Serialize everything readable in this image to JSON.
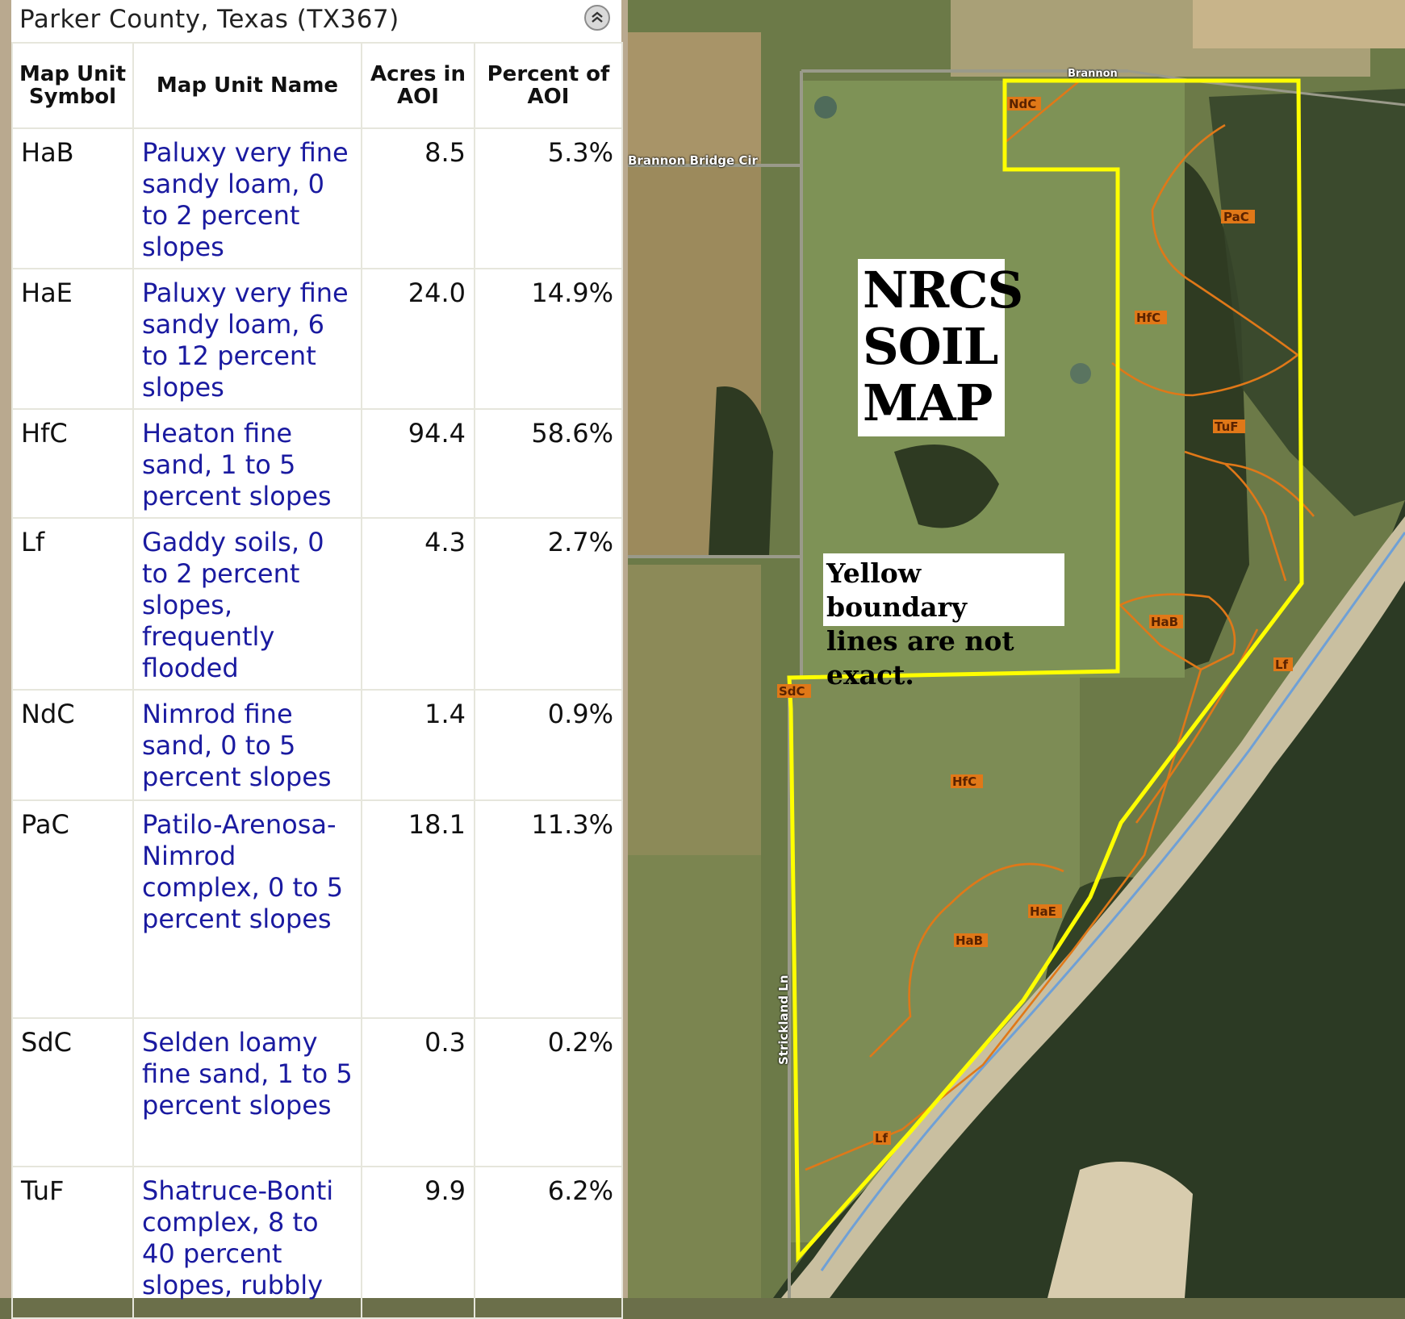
{
  "panel": {
    "title": "Parker County, Texas (TX367)",
    "collapse_icon": "double-chevron-up-icon"
  },
  "table": {
    "headers": {
      "symbol": "Map Unit Symbol",
      "name": "Map Unit Name",
      "acres": "Acres in AOI",
      "percent": "Percent of AOI"
    },
    "rows": [
      {
        "symbol": "HaB",
        "name": "Paluxy very fine sandy loam, 0 to 2 percent slopes",
        "acres": "8.5",
        "percent": "5.3%"
      },
      {
        "symbol": "HaE",
        "name": "Paluxy very fine sandy loam, 6 to 12 percent slopes",
        "acres": "24.0",
        "percent": "14.9%"
      },
      {
        "symbol": "HfC",
        "name": "Heaton fine sand, 1 to 5 percent slopes",
        "acres": "94.4",
        "percent": "58.6%"
      },
      {
        "symbol": "Lf",
        "name": "Gaddy soils, 0 to 2 percent slopes, frequently flooded",
        "acres": "4.3",
        "percent": "2.7%"
      },
      {
        "symbol": "NdC",
        "name": "Nimrod fine sand, 0 to 5 percent slopes",
        "acres": "1.4",
        "percent": "0.9%"
      },
      {
        "symbol": "PaC",
        "name": "Patilo-Arenosa-Nimrod complex, 0 to 5 percent slopes",
        "acres": "18.1",
        "percent": "11.3%"
      },
      {
        "symbol": "SdC",
        "name": "Selden loamy fine sand, 1 to 5 percent slopes",
        "acres": "0.3",
        "percent": "0.2%"
      },
      {
        "symbol": "TuF",
        "name": "Shatruce-Bonti complex, 8 to 40 percent slopes, rubbly",
        "acres": "9.9",
        "percent": "6.2%"
      }
    ]
  },
  "map": {
    "title_lines": [
      "NRCS",
      "SOIL",
      "MAP"
    ],
    "note_lines": [
      "Yellow boundary",
      "lines are not exact."
    ],
    "road_labels": {
      "brannon": "Brannon Bridge Cir",
      "strickland": "Strickland Ln",
      "top": "Brannon"
    },
    "soil_labels": [
      "NdC",
      "PaC",
      "HfC",
      "TuF",
      "HaB",
      "Lf",
      "SdC",
      "HfC",
      "HaE",
      "HaB",
      "Lf"
    ],
    "colors": {
      "boundary": "#ffff00",
      "soil_lines": "#e07818",
      "river": "#6fa0d6"
    }
  }
}
